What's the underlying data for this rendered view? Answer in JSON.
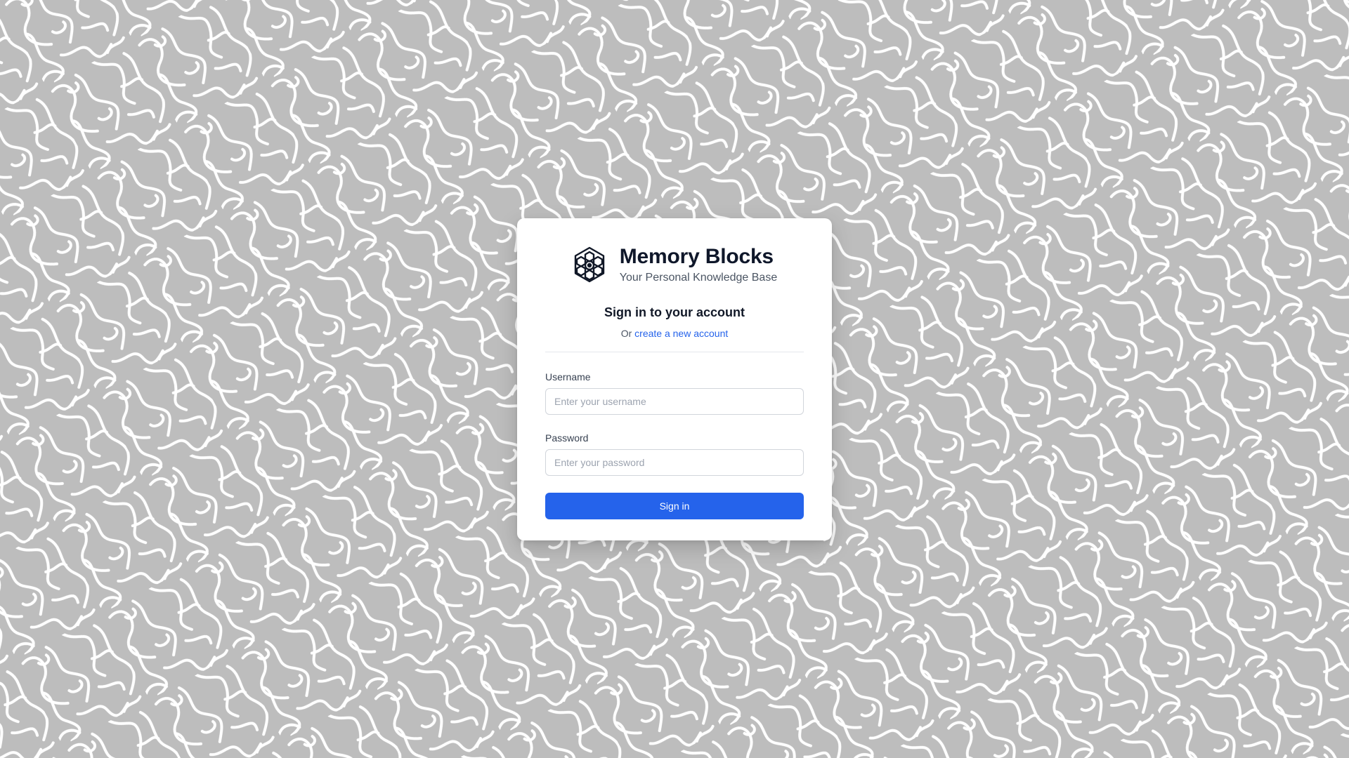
{
  "app": {
    "title": "Memory Blocks",
    "subtitle": "Your Personal Knowledge Base",
    "logo_icon": "hexagonal-cube-icon"
  },
  "signin": {
    "heading": "Sign in to your account",
    "or_text": "Or ",
    "create_account_link": "create a new account",
    "username": {
      "label": "Username",
      "placeholder": "Enter your username",
      "value": ""
    },
    "password": {
      "label": "Password",
      "placeholder": "Enter your password",
      "value": ""
    },
    "submit_label": "Sign in"
  },
  "colors": {
    "accent": "#2563eb",
    "background_pattern": "#bdbdbd",
    "card": "#ffffff"
  }
}
